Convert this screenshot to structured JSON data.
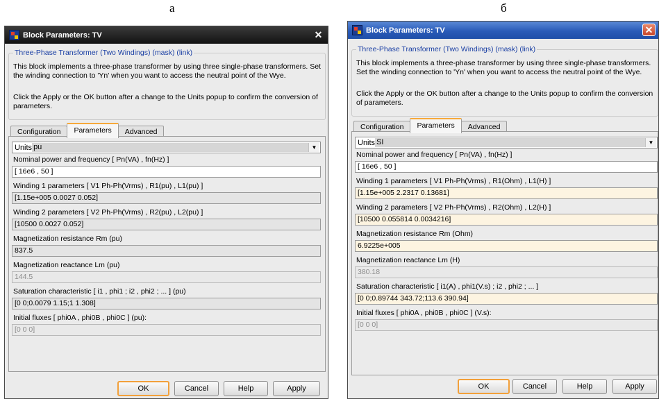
{
  "captions": {
    "left": "а",
    "right": "б"
  },
  "window": {
    "title": "Block Parameters: TV",
    "close_glyph": "✕"
  },
  "mask": {
    "heading": "Three-Phase Transformer (Two Windings) (mask) (link)",
    "description": "This block implements a three-phase transformer by using three single-phase transformers. Set the winding connection to 'Yn'  when you want to access the neutral point of the Wye.",
    "note": "Click the Apply or the OK button after a change to the Units popup to confirm the conversion of parameters."
  },
  "tabs": [
    "Configuration",
    "Parameters",
    "Advanced"
  ],
  "active_tab": "Parameters",
  "buttons": {
    "ok": "OK",
    "cancel": "Cancel",
    "help": "Help",
    "apply": "Apply"
  },
  "units_label": "Units",
  "dropdown_icon": "chevron-down-icon",
  "dialog_a": {
    "units_value": "pu",
    "params": [
      {
        "label": "Nominal power and frequency  [ Pn(VA) , fn(Hz) ]",
        "value": "[ 16e6 , 50 ]",
        "state": "editable"
      },
      {
        "label": "Winding 1 parameters [ V1 Ph-Ph(Vrms) , R1(pu) , L1(pu) ]",
        "value": "[1.15e+005 0.0027 0.052]",
        "state": "readonly"
      },
      {
        "label": "Winding 2 parameters [ V2 Ph-Ph(Vrms) , R2(pu) , L2(pu) ]",
        "value": "[10500 0.0027 0.052]",
        "state": "readonly"
      },
      {
        "label": "Magnetization resistance  Rm (pu)",
        "value": "837.5",
        "state": "readonly"
      },
      {
        "label": "Magnetization reactance  Lm (pu)",
        "value": "144.5",
        "state": "disabled"
      },
      {
        "label": "Saturation characteristic [ i1 ,  phi1 ;  i2 , phi2 ; ... ] (pu)",
        "value": "[0 0;0.0079 1.15;1 1.308]",
        "state": "readonly"
      },
      {
        "label": "Initial fluxes [ phi0A , phi0B , phi0C ] (pu):",
        "value": "[0 0 0]",
        "state": "disabled"
      }
    ]
  },
  "dialog_b": {
    "units_value": "SI",
    "params": [
      {
        "label": "Nominal power and frequency  [ Pn(VA) , fn(Hz) ]",
        "value": "[ 16e6 , 50 ]",
        "state": "editable"
      },
      {
        "label": "Winding 1 parameters [ V1 Ph-Ph(Vrms) , R1(Ohm) , L1(H) ]",
        "value": "[1.15e+005 2.2317 0.13681]",
        "state": "highlight"
      },
      {
        "label": "Winding 2 parameters [ V2 Ph-Ph(Vrms) , R2(Ohm) , L2(H) ]",
        "value": "[10500 0.055814 0.0034216]",
        "state": "highlight"
      },
      {
        "label": "Magnetization resistance  Rm (Ohm)",
        "value": "6.9225e+005",
        "state": "highlight"
      },
      {
        "label": "Magnetization reactance  Lm (H)",
        "value": "380.18",
        "state": "disabled"
      },
      {
        "label": "Saturation characteristic [ i1(A) ,  phi1(V.s) ;  i2 , phi2 ; ... ]",
        "value": "[0 0;0.89744 343.72;113.6 390.94]",
        "state": "highlight"
      },
      {
        "label": "Initial fluxes [ phi0A , phi0B , phi0C ] (V.s):",
        "value": "[0 0 0]",
        "state": "disabled"
      }
    ]
  },
  "colors": {
    "dialog_bg": "#ebebeb",
    "link_blue": "#1a3fa4",
    "active_tab_accent": "#f6a93b",
    "readonly_field": "#e4e4e4",
    "highlight_field": "#fdf4e1"
  }
}
